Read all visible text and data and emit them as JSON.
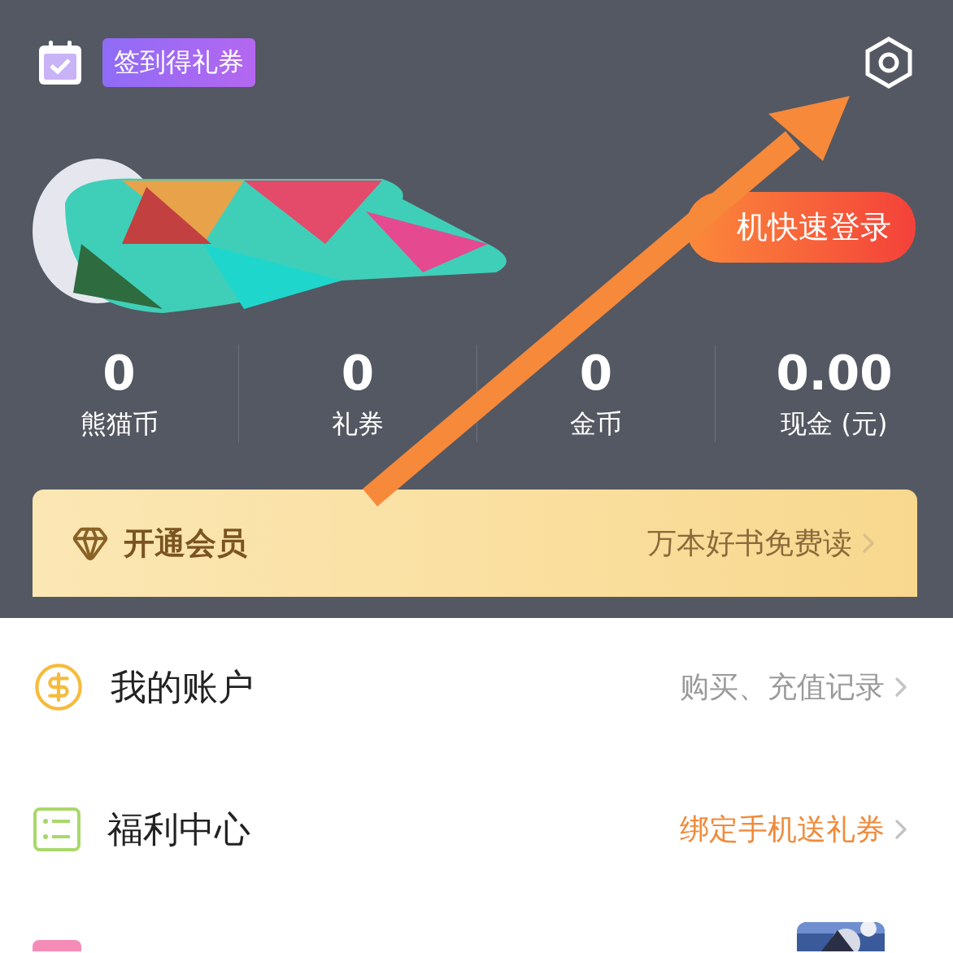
{
  "header": {
    "checkin_badge": "签到得礼券",
    "login_button": "机快速登录"
  },
  "stats": [
    {
      "value": "0",
      "label": "熊猫币"
    },
    {
      "value": "0",
      "label": "礼券"
    },
    {
      "value": "0",
      "label": "金币"
    },
    {
      "value": "0.00",
      "label": "现金 (元)"
    }
  ],
  "vip_banner": {
    "title": "开通会员",
    "subtitle": "万本好书免费读"
  },
  "menu": [
    {
      "kind": "account",
      "title": "我的账户",
      "hint": "购买、充值记录",
      "highlight": false
    },
    {
      "kind": "welfare",
      "title": "福利中心",
      "hint": "绑定手机送礼券",
      "highlight": true
    },
    {
      "kind": "cut_off"
    }
  ]
}
